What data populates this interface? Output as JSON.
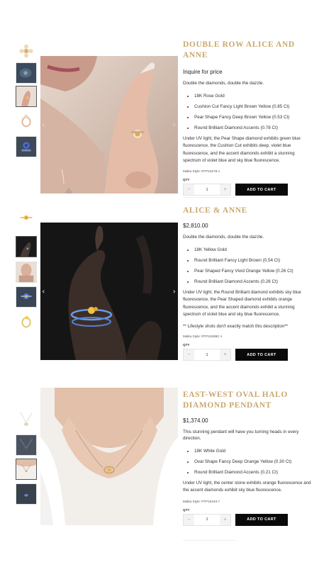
{
  "products": [
    {
      "title": "DOUBLE ROW ALICE AND ANNE",
      "price": "Inquire for price",
      "description": "Double the diamonds, double the dazzle.",
      "bullets": [
        "18K Rose Gold",
        "Cushion Cut Fancy Light Brown Yellow (0.85 Ct)",
        "Pear Shape Fancy Deep Brown Yellow (0.53 Ct)",
        "Round Brilliant Diamond Accents (0.78 Ct)"
      ],
      "uv_text": "Under UV light, the Pear Shape diamond exhibits green blue fluorescence, the Cushion Cut exhibits deep, violet blue fluorescence, and the accent diamonds exhibit a stunning spectrum of violet blue and sky blue fluorescence.",
      "style_code": "Malka Style: RTP16278-1",
      "qty_label": "QTY",
      "qty_value": "1",
      "cart_label": "ADD TO CART"
    },
    {
      "title": "ALICE & ANNE",
      "price": "$2,810.00",
      "description": "Double the diamonds, double the dazzle.",
      "bullets": [
        "18K Yellow Gold",
        "Round Brilliant Fancy Light Brown (0.54 Ct)",
        "Pear Shaped Fancy Vivid Orange Yellow (0.26 Ct)",
        "Round Brilliant Diamond Accents (0.26 Ct)"
      ],
      "uv_text": "Under UV light, the Round Brilliant diamond exhibits sky blue fluorescence, the Pear Shaped diamond exhibits orange fluorescence, and the accent diamonds exhibit a stunning spectrum of violet blue and sky blue fluorescence.",
      "note": "** Lifestyle shots don't exactly match this description**",
      "style_code": "Malka Style: RTP16369C-1",
      "qty_label": "QTY",
      "qty_value": "1",
      "cart_label": "ADD TO CART"
    },
    {
      "title": "EAST-WEST OVAL HALO DIAMOND PENDANT",
      "price": "$1,374.00",
      "description": "This stunning pendant will have you turning heads in every direction.",
      "bullets": [
        "18K White Gold",
        "Oval Shape Fancy Deep Orange Yellow (0.30 Ct)",
        "Round Brilliant Diamond Accents (0.21 Ct)"
      ],
      "uv_text": "Under UV light, the center stone exhibits orange fluorescence and the accent diamonds exhibit sky blue fluorescence.",
      "style_code": "Malka Style: PTP16443-7",
      "qty_label": "QTY",
      "qty_value": "1",
      "cart_label": "ADD TO CART"
    }
  ],
  "icons": {
    "prev": "‹",
    "next": "›",
    "minus": "−",
    "plus": "+"
  },
  "colors": {
    "title_gold": "#c9a86d",
    "cart_button": "#0a0a0a"
  }
}
